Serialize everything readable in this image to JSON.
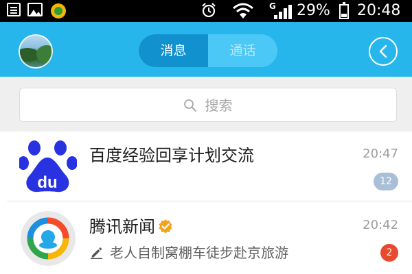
{
  "status_bar": {
    "battery_percent": "29%",
    "battery_level": 0.29,
    "time": "20:48",
    "network_type": "G",
    "icons": [
      "notes-icon",
      "image-icon",
      "app-icon",
      "alarm-icon",
      "wifi-icon",
      "signal-icon",
      "battery-icon"
    ]
  },
  "header": {
    "tabs": [
      {
        "label": "消息",
        "active": true
      },
      {
        "label": "通话",
        "active": false
      }
    ],
    "colors": {
      "bar": "#27b6ec",
      "tab_active": "#1191cd",
      "tab_track": "#4cc8f6"
    }
  },
  "search": {
    "placeholder": "搜索"
  },
  "conversations": [
    {
      "name": "百度经验回享计划交流",
      "time": "20:47",
      "unread": "12",
      "badge_color": "#a8bfd7",
      "avatar_icon": "baidu-paw-icon"
    },
    {
      "name": "腾讯新闻",
      "time": "20:42",
      "preview": "老人自制窝棚车徒步赴京旅游",
      "unread": "2",
      "badge_color": "#e84a2f",
      "avatar_icon": "tencent-news-icon",
      "verified": true
    }
  ]
}
